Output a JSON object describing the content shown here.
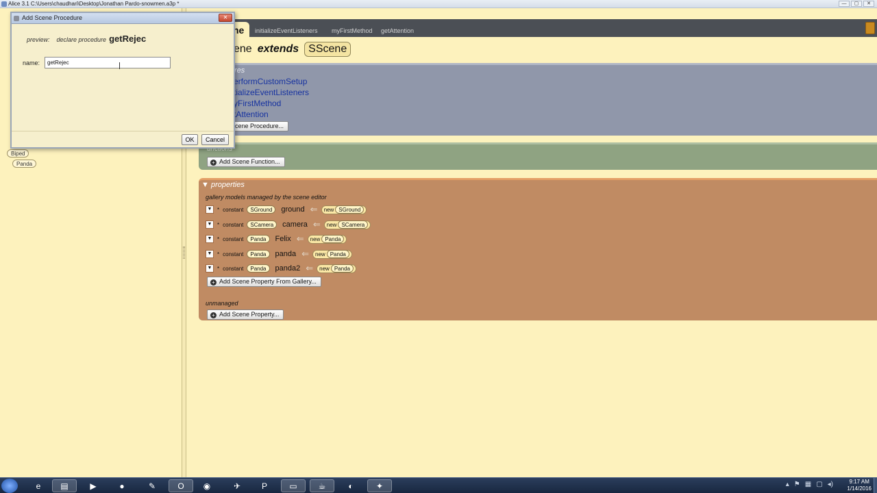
{
  "window": {
    "title": "Alice 3.1 C:\\Users\\chaudhari\\Desktop\\Jonathan Pardo-snowmen.a3p *",
    "controls": [
      "—",
      "▢",
      "✕"
    ]
  },
  "left_panel": {
    "type_tags": [
      "Biped",
      "Panda"
    ]
  },
  "editor": {
    "tabs": {
      "active": "ne",
      "others": [
        "initializeEventListeners",
        "myFirstMethod",
        "getAttention"
      ]
    },
    "class_header": {
      "name": "ene",
      "keyword": "extends",
      "superclass": "SScene"
    },
    "procedures": {
      "label": "res",
      "items": [
        "erformCustomSetup",
        "tializeEventListeners",
        "yFirstMethod",
        "tAttention"
      ],
      "add_button": "cene Procedure..."
    },
    "functions": {
      "label": "unctions",
      "add_button": "Add Scene Function..."
    },
    "properties": {
      "title": "properties",
      "managed_label": "gallery models managed by the scene editor",
      "rows": [
        {
          "star": "*",
          "modifier": "constant",
          "type": "SGround",
          "name": "ground",
          "new_kw": "new",
          "new_type": "SGround"
        },
        {
          "star": "*",
          "modifier": "constant",
          "type": "SCamera",
          "name": "camera",
          "new_kw": "new",
          "new_type": "SCamera"
        },
        {
          "star": "*",
          "modifier": "constant",
          "type": "Panda",
          "name": "Felix",
          "new_kw": "new",
          "new_type": "Panda"
        },
        {
          "star": "*",
          "modifier": "constant",
          "type": "Panda",
          "name": "panda",
          "new_kw": "new",
          "new_type": "Panda"
        },
        {
          "star": "*",
          "modifier": "constant",
          "type": "Panda",
          "name": "panda2",
          "new_kw": "new",
          "new_type": "Panda"
        }
      ],
      "add_gallery_button": "Add Scene Property From Gallery...",
      "unmanaged_label": "unmanaged",
      "add_property_button": "Add Scene Property..."
    }
  },
  "dialog": {
    "title": "Add Scene Procedure",
    "close": "✕",
    "preview_label": "preview:",
    "preview_decl": "declare procedure",
    "preview_name": "getRejec",
    "name_label": "name:",
    "name_value": "getRejec",
    "ok_label": "OK",
    "cancel_label": "Cancel"
  },
  "taskbar": {
    "icons": [
      "internet-explorer-icon",
      "file-explorer-icon",
      "media-player-icon",
      "firefox-icon",
      "tools-icon",
      "outlook-icon",
      "chrome-icon",
      "app-icon",
      "powerpoint-icon",
      "terminal-icon",
      "java-icon",
      "alice-icon",
      "paint-icon"
    ],
    "time": "9:17 AM",
    "date": "1/14/2016"
  }
}
